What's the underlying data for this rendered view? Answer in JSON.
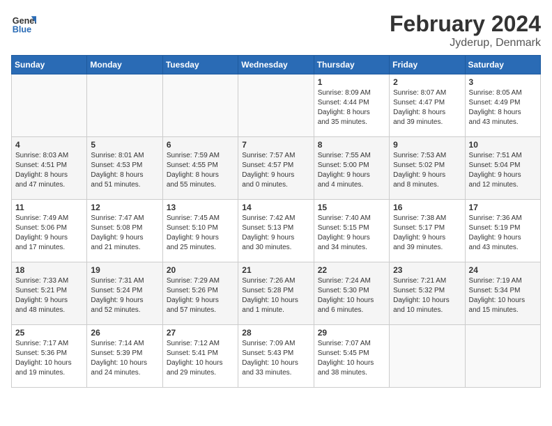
{
  "header": {
    "logo_line1": "General",
    "logo_line2": "Blue",
    "title": "February 2024",
    "subtitle": "Jyderup, Denmark"
  },
  "weekdays": [
    "Sunday",
    "Monday",
    "Tuesday",
    "Wednesday",
    "Thursday",
    "Friday",
    "Saturday"
  ],
  "weeks": [
    [
      {
        "day": "",
        "info": ""
      },
      {
        "day": "",
        "info": ""
      },
      {
        "day": "",
        "info": ""
      },
      {
        "day": "",
        "info": ""
      },
      {
        "day": "1",
        "info": "Sunrise: 8:09 AM\nSunset: 4:44 PM\nDaylight: 8 hours\nand 35 minutes."
      },
      {
        "day": "2",
        "info": "Sunrise: 8:07 AM\nSunset: 4:47 PM\nDaylight: 8 hours\nand 39 minutes."
      },
      {
        "day": "3",
        "info": "Sunrise: 8:05 AM\nSunset: 4:49 PM\nDaylight: 8 hours\nand 43 minutes."
      }
    ],
    [
      {
        "day": "4",
        "info": "Sunrise: 8:03 AM\nSunset: 4:51 PM\nDaylight: 8 hours\nand 47 minutes."
      },
      {
        "day": "5",
        "info": "Sunrise: 8:01 AM\nSunset: 4:53 PM\nDaylight: 8 hours\nand 51 minutes."
      },
      {
        "day": "6",
        "info": "Sunrise: 7:59 AM\nSunset: 4:55 PM\nDaylight: 8 hours\nand 55 minutes."
      },
      {
        "day": "7",
        "info": "Sunrise: 7:57 AM\nSunset: 4:57 PM\nDaylight: 9 hours\nand 0 minutes."
      },
      {
        "day": "8",
        "info": "Sunrise: 7:55 AM\nSunset: 5:00 PM\nDaylight: 9 hours\nand 4 minutes."
      },
      {
        "day": "9",
        "info": "Sunrise: 7:53 AM\nSunset: 5:02 PM\nDaylight: 9 hours\nand 8 minutes."
      },
      {
        "day": "10",
        "info": "Sunrise: 7:51 AM\nSunset: 5:04 PM\nDaylight: 9 hours\nand 12 minutes."
      }
    ],
    [
      {
        "day": "11",
        "info": "Sunrise: 7:49 AM\nSunset: 5:06 PM\nDaylight: 9 hours\nand 17 minutes."
      },
      {
        "day": "12",
        "info": "Sunrise: 7:47 AM\nSunset: 5:08 PM\nDaylight: 9 hours\nand 21 minutes."
      },
      {
        "day": "13",
        "info": "Sunrise: 7:45 AM\nSunset: 5:10 PM\nDaylight: 9 hours\nand 25 minutes."
      },
      {
        "day": "14",
        "info": "Sunrise: 7:42 AM\nSunset: 5:13 PM\nDaylight: 9 hours\nand 30 minutes."
      },
      {
        "day": "15",
        "info": "Sunrise: 7:40 AM\nSunset: 5:15 PM\nDaylight: 9 hours\nand 34 minutes."
      },
      {
        "day": "16",
        "info": "Sunrise: 7:38 AM\nSunset: 5:17 PM\nDaylight: 9 hours\nand 39 minutes."
      },
      {
        "day": "17",
        "info": "Sunrise: 7:36 AM\nSunset: 5:19 PM\nDaylight: 9 hours\nand 43 minutes."
      }
    ],
    [
      {
        "day": "18",
        "info": "Sunrise: 7:33 AM\nSunset: 5:21 PM\nDaylight: 9 hours\nand 48 minutes."
      },
      {
        "day": "19",
        "info": "Sunrise: 7:31 AM\nSunset: 5:24 PM\nDaylight: 9 hours\nand 52 minutes."
      },
      {
        "day": "20",
        "info": "Sunrise: 7:29 AM\nSunset: 5:26 PM\nDaylight: 9 hours\nand 57 minutes."
      },
      {
        "day": "21",
        "info": "Sunrise: 7:26 AM\nSunset: 5:28 PM\nDaylight: 10 hours\nand 1 minute."
      },
      {
        "day": "22",
        "info": "Sunrise: 7:24 AM\nSunset: 5:30 PM\nDaylight: 10 hours\nand 6 minutes."
      },
      {
        "day": "23",
        "info": "Sunrise: 7:21 AM\nSunset: 5:32 PM\nDaylight: 10 hours\nand 10 minutes."
      },
      {
        "day": "24",
        "info": "Sunrise: 7:19 AM\nSunset: 5:34 PM\nDaylight: 10 hours\nand 15 minutes."
      }
    ],
    [
      {
        "day": "25",
        "info": "Sunrise: 7:17 AM\nSunset: 5:36 PM\nDaylight: 10 hours\nand 19 minutes."
      },
      {
        "day": "26",
        "info": "Sunrise: 7:14 AM\nSunset: 5:39 PM\nDaylight: 10 hours\nand 24 minutes."
      },
      {
        "day": "27",
        "info": "Sunrise: 7:12 AM\nSunset: 5:41 PM\nDaylight: 10 hours\nand 29 minutes."
      },
      {
        "day": "28",
        "info": "Sunrise: 7:09 AM\nSunset: 5:43 PM\nDaylight: 10 hours\nand 33 minutes."
      },
      {
        "day": "29",
        "info": "Sunrise: 7:07 AM\nSunset: 5:45 PM\nDaylight: 10 hours\nand 38 minutes."
      },
      {
        "day": "",
        "info": ""
      },
      {
        "day": "",
        "info": ""
      }
    ]
  ]
}
